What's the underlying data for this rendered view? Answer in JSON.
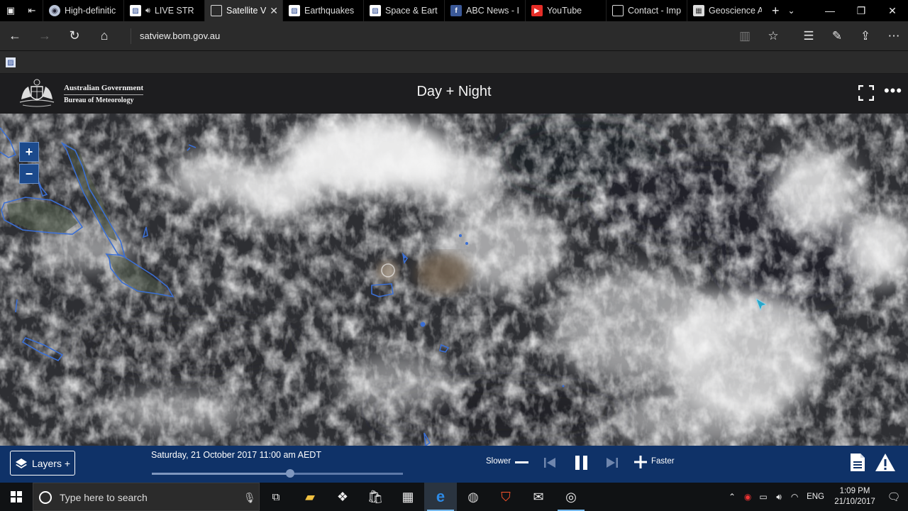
{
  "browser": {
    "tabs": [
      {
        "title": "High-definitic",
        "icon": "globe-icon",
        "active": false
      },
      {
        "title": "LIVE STR",
        "icon": "bom-icon",
        "audio": true,
        "active": false
      },
      {
        "title": "Satellite V",
        "icon": "page-icon",
        "active": true
      },
      {
        "title": "Earthquakes",
        "icon": "bom-icon",
        "active": false
      },
      {
        "title": "Space & Eart",
        "icon": "bom-icon",
        "active": false
      },
      {
        "title": "ABC News - I",
        "icon": "facebook-icon",
        "active": false
      },
      {
        "title": "YouTube",
        "icon": "youtube-icon",
        "active": false
      },
      {
        "title": "Contact - Imp",
        "icon": "page-icon",
        "active": false
      },
      {
        "title": "Geoscience A",
        "icon": "geoscience-icon",
        "active": false
      }
    ],
    "url_domain": "satview.bom.gov.au",
    "url_prefix": ""
  },
  "site": {
    "gov_name": "Australian Government",
    "agency_name": "Bureau of Meteorology",
    "view_title": "Day + Night",
    "zoom_in_label": "+",
    "zoom_out_label": "−"
  },
  "player": {
    "layers_label": "Layers +",
    "timestamp": "Saturday, 21 October 2017 11:00 am AEDT",
    "timeline_position": 0.55,
    "slower_label": "Slower",
    "faster_label": "Faster",
    "state": "playing"
  },
  "taskbar": {
    "search_placeholder": "Type here to search",
    "language": "ENG",
    "time": "1:09 PM",
    "date": "21/10/2017",
    "apps": [
      "task-view-icon",
      "file-explorer-icon",
      "dropbox-icon",
      "store-icon",
      "calculator-icon",
      "edge-icon",
      "globe-app-icon",
      "brave-icon",
      "mail-icon",
      "obs-icon"
    ]
  },
  "colors": {
    "header_bg": "#1d1d1f",
    "player_bg": "#0f3268",
    "zoom_bg": "#1c4a8c",
    "coastline": "#3b6fd4"
  }
}
